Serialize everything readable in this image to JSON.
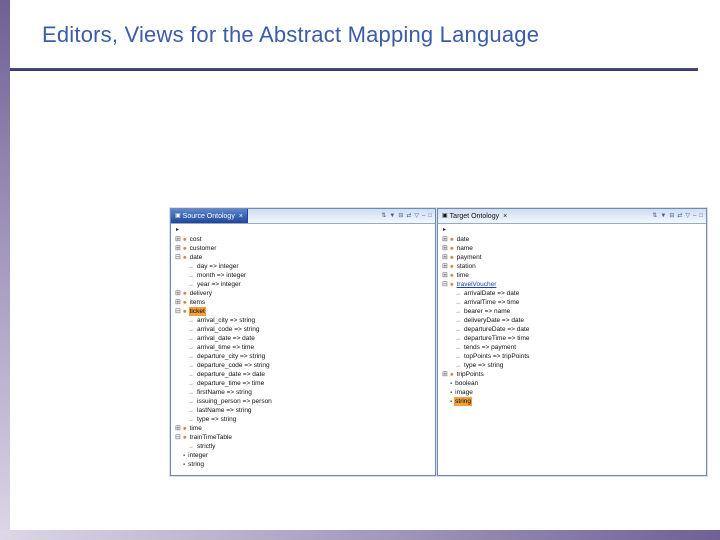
{
  "slide": {
    "title": "Editors, Views for the Abstract Mapping Language"
  },
  "colors": {
    "title": "#3b5ca8",
    "divider": "#32325e",
    "selection": "#f2a23c",
    "link": "#1a3fae",
    "strip_dark": "#6f6096",
    "strip_light": "#ddd7e8",
    "tab_active_top": "#5d87cf",
    "tab_active_bottom": "#1f4796"
  },
  "glyphs": {
    "tree_icons": {
      "root": "▸",
      "concept": "●",
      "property": "→",
      "datatype": "▪"
    },
    "expand": {
      "plus": "⊞",
      "minus": "⊟"
    }
  },
  "source_panel": {
    "tab": {
      "icon_glyph": "▣",
      "label": "Source Ontology",
      "close_glyph": "×"
    },
    "toolbar_icons": [
      {
        "name": "sort-icon",
        "glyph": "⇅"
      },
      {
        "name": "filter-icon",
        "glyph": "▼"
      },
      {
        "name": "collapse-all-icon",
        "glyph": "⊟"
      },
      {
        "name": "link-with-editor-icon",
        "glyph": "⇄"
      },
      {
        "name": "view-menu-icon",
        "glyph": "▽"
      },
      {
        "name": "minimize-icon",
        "glyph": "–"
      },
      {
        "name": "maximize-icon",
        "glyph": "□"
      }
    ],
    "tree": [
      {
        "label": "",
        "kind": "root",
        "level": 0
      },
      {
        "label": "cost",
        "kind": "concept",
        "level": 0,
        "expand": "plus"
      },
      {
        "label": "customer",
        "kind": "concept",
        "level": 0,
        "expand": "plus"
      },
      {
        "label": "date",
        "kind": "concept",
        "level": 0,
        "expand": "minus"
      },
      {
        "label": "day => integer",
        "kind": "property",
        "level": 1
      },
      {
        "label": "month => integer",
        "kind": "property",
        "level": 1
      },
      {
        "label": "year => integer",
        "kind": "property",
        "level": 1
      },
      {
        "label": "delivery",
        "kind": "concept",
        "level": 0,
        "expand": "plus"
      },
      {
        "label": "items",
        "kind": "concept",
        "level": 0,
        "expand": "plus"
      },
      {
        "label": "ticket",
        "kind": "concept",
        "level": 0,
        "expand": "minus",
        "selected": true
      },
      {
        "label": "arrival_city => string",
        "kind": "property",
        "level": 1
      },
      {
        "label": "arrival_code => string",
        "kind": "property",
        "level": 1
      },
      {
        "label": "arrival_date => date",
        "kind": "property",
        "level": 1
      },
      {
        "label": "arrival_time => time",
        "kind": "property",
        "level": 1
      },
      {
        "label": "departure_city => string",
        "kind": "property",
        "level": 1
      },
      {
        "label": "departure_code => string",
        "kind": "property",
        "level": 1
      },
      {
        "label": "departure_date => date",
        "kind": "property",
        "level": 1
      },
      {
        "label": "departure_time => time",
        "kind": "property",
        "level": 1
      },
      {
        "label": "firstName => string",
        "kind": "property",
        "level": 1
      },
      {
        "label": "issuing_person => person",
        "kind": "property",
        "level": 1
      },
      {
        "label": "lastName => string",
        "kind": "property",
        "level": 1
      },
      {
        "label": "type => string",
        "kind": "property",
        "level": 1
      },
      {
        "label": "time",
        "kind": "concept",
        "level": 0,
        "expand": "plus"
      },
      {
        "label": "trainTimeTable",
        "kind": "concept",
        "level": 0,
        "expand": "minus"
      },
      {
        "label": "strictly",
        "kind": "property",
        "level": 1
      },
      {
        "label": "integer",
        "kind": "datatype",
        "level": 0
      },
      {
        "label": "string",
        "kind": "datatype",
        "level": 0
      }
    ]
  },
  "target_panel": {
    "tab": {
      "icon_glyph": "▣",
      "label": "Target Ontology",
      "close_glyph": "×"
    },
    "toolbar_icons": [
      {
        "name": "sort-icon",
        "glyph": "⇅"
      },
      {
        "name": "filter-icon",
        "glyph": "▼"
      },
      {
        "name": "collapse-all-icon",
        "glyph": "⊟"
      },
      {
        "name": "link-with-editor-icon",
        "glyph": "⇄"
      },
      {
        "name": "view-menu-icon",
        "glyph": "▽"
      },
      {
        "name": "minimize-icon",
        "glyph": "–"
      },
      {
        "name": "maximize-icon",
        "glyph": "□"
      }
    ],
    "tree": [
      {
        "label": "",
        "kind": "root",
        "level": 0
      },
      {
        "label": "date",
        "kind": "concept",
        "level": 0,
        "expand": "plus"
      },
      {
        "label": "name",
        "kind": "concept",
        "level": 0,
        "expand": "plus"
      },
      {
        "label": "payment",
        "kind": "concept",
        "level": 0,
        "expand": "plus"
      },
      {
        "label": "station",
        "kind": "concept",
        "level": 0,
        "expand": "plus"
      },
      {
        "label": "time",
        "kind": "concept",
        "level": 0,
        "expand": "plus"
      },
      {
        "label": "travelVoucher",
        "kind": "concept",
        "level": 0,
        "expand": "minus",
        "link": true
      },
      {
        "label": "arrivalDate => date",
        "kind": "property",
        "level": 1
      },
      {
        "label": "arrivalTime => time",
        "kind": "property",
        "level": 1
      },
      {
        "label": "bearer => name",
        "kind": "property",
        "level": 1
      },
      {
        "label": "deliveryDate => date",
        "kind": "property",
        "level": 1
      },
      {
        "label": "departureDate => date",
        "kind": "property",
        "level": 1
      },
      {
        "label": "departureTime => time",
        "kind": "property",
        "level": 1
      },
      {
        "label": "tends => payment",
        "kind": "property",
        "level": 1
      },
      {
        "label": "topPoints => tripPoints",
        "kind": "property",
        "level": 1
      },
      {
        "label": "type => string",
        "kind": "property",
        "level": 1
      },
      {
        "label": "tripPoints",
        "kind": "concept",
        "level": 0,
        "expand": "plus"
      },
      {
        "label": "boolean",
        "kind": "datatype",
        "level": 0
      },
      {
        "label": "image",
        "kind": "datatype",
        "level": 0
      },
      {
        "label": "string",
        "kind": "datatype",
        "level": 0,
        "selected": true
      }
    ]
  }
}
